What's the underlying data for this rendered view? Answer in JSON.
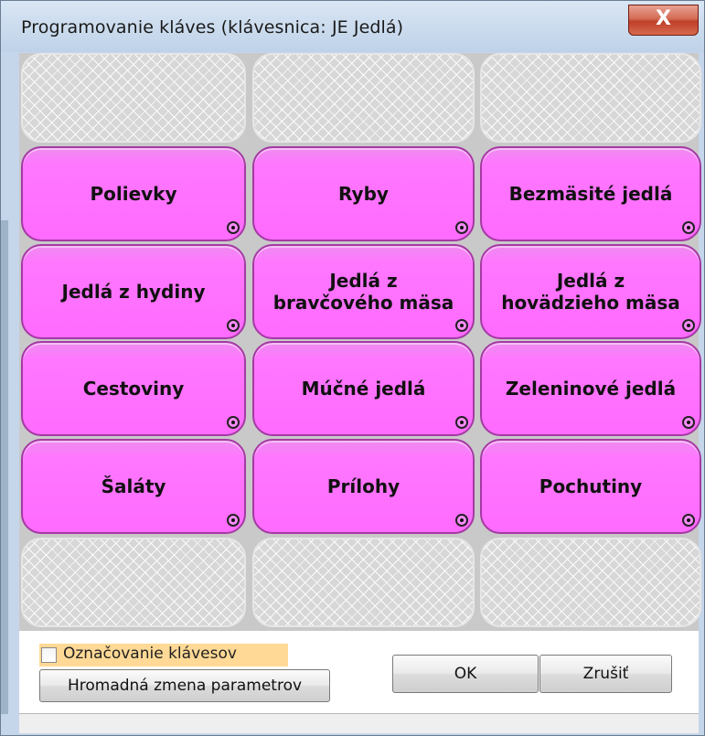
{
  "window": {
    "title": "Programovanie kláves (klávesnica: JE  Jedlá)",
    "close_label": "X"
  },
  "keys": [
    {
      "label": "",
      "empty": true
    },
    {
      "label": "",
      "empty": true
    },
    {
      "label": "",
      "empty": true
    },
    {
      "label": "Polievky",
      "empty": false
    },
    {
      "label": "Ryby",
      "empty": false
    },
    {
      "label": "Bezmäsité jedlá",
      "empty": false
    },
    {
      "label": "Jedlá z hydiny",
      "empty": false
    },
    {
      "label": "Jedlá z\nbravčového mäsa",
      "empty": false
    },
    {
      "label": "Jedlá z\nhovädzieho mäsa",
      "empty": false
    },
    {
      "label": "Cestoviny",
      "empty": false
    },
    {
      "label": "Múčné jedlá",
      "empty": false
    },
    {
      "label": "Zeleninové jedlá",
      "empty": false
    },
    {
      "label": "Šaláty",
      "empty": false
    },
    {
      "label": "Prílohy",
      "empty": false
    },
    {
      "label": "Pochutiny",
      "empty": false
    },
    {
      "label": "",
      "empty": true
    },
    {
      "label": "",
      "empty": true
    },
    {
      "label": "",
      "empty": true
    }
  ],
  "footer": {
    "checkbox_label": "Označovanie klávesov",
    "checkbox_checked": false,
    "bulk_button_label": "Hromadná zmena parametrov",
    "ok_label": "OK",
    "cancel_label": "Zrušiť"
  },
  "colors": {
    "key_fill": "#ff6bff",
    "key_border": "#a43aa3",
    "checkbox_highlight": "#ffd995"
  },
  "icons": {
    "key_marker": "radio-dot-icon",
    "close": "close-icon"
  }
}
